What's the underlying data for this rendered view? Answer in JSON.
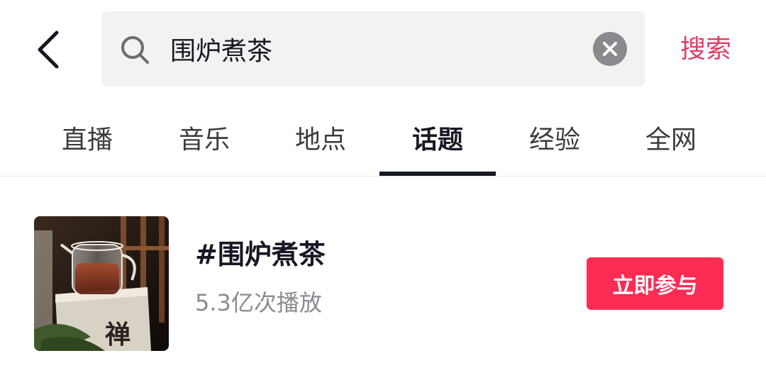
{
  "search": {
    "query": "围炉煮茶",
    "submit_label": "搜索"
  },
  "tabs": [
    {
      "label": "直播",
      "active": false
    },
    {
      "label": "音乐",
      "active": false
    },
    {
      "label": "地点",
      "active": false
    },
    {
      "label": "话题",
      "active": true
    },
    {
      "label": "经验",
      "active": false
    },
    {
      "label": "全网",
      "active": false
    }
  ],
  "result": {
    "title": "#围炉煮茶",
    "plays": "5.3亿次播放",
    "join_label": "立即参与",
    "thumbnail_text": "禅"
  },
  "colors": {
    "accent": "#fe2c55",
    "search_label": "#e03c66",
    "text_primary": "#161823",
    "text_secondary": "#8a8b91",
    "search_bg": "#f2f2f2"
  },
  "icons": {
    "back": "chevron-left-icon",
    "search": "search-icon",
    "clear": "close-icon"
  }
}
